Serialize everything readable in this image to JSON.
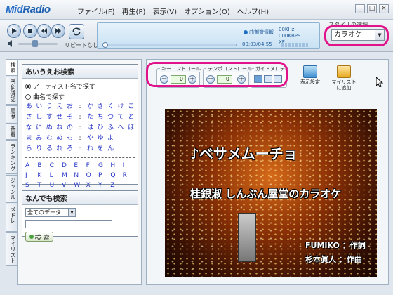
{
  "app": {
    "logo_part1": "Mid",
    "logo_part2": "Radio"
  },
  "menu": [
    "ファイル(F)",
    "再生(P)",
    "表示(V)",
    "オプション(O)",
    "ヘルプ(H)"
  ],
  "window_buttons": [
    "_",
    "□",
    "×"
  ],
  "player": {
    "repeat_label": "リピートなし",
    "status_text": "曲御遊情報",
    "khz": "00KHz",
    "kbps": "000KBPS",
    "xf": "XF",
    "time": "00:03/04:55"
  },
  "style_select": {
    "label": "スタイルの選択",
    "value": "カラオケ"
  },
  "side_tabs": [
    "検索",
    "予約確認",
    "履歴",
    "新着",
    "ランキング",
    "ジャンル",
    "メドレー",
    "マイリスト"
  ],
  "kana_search": {
    "title": "あいうえお検索",
    "options": [
      "アーティスト名で探す",
      "曲名で探す"
    ],
    "selected_index": 0,
    "kana_rows": [
      [
        "あ",
        "い",
        "う",
        "え",
        "お",
        ":",
        "か",
        "き",
        "く",
        "け",
        "こ"
      ],
      [
        "さ",
        "し",
        "す",
        "せ",
        "そ",
        ":",
        "た",
        "ち",
        "つ",
        "て",
        "と"
      ],
      [
        "な",
        "に",
        "ぬ",
        "ね",
        "の",
        ":",
        "は",
        "ひ",
        "ふ",
        "へ",
        "ほ"
      ],
      [
        "ま",
        "み",
        "む",
        "め",
        "も",
        ":",
        "や",
        "ゆ",
        "よ"
      ],
      [
        "ら",
        "り",
        "る",
        "れ",
        "ろ",
        ":",
        "わ",
        "を",
        "ん"
      ]
    ],
    "alpha": [
      "A",
      "B",
      "C",
      "D",
      "E",
      "F",
      "G",
      "H",
      "I",
      "J",
      "K",
      "L",
      "M",
      "N",
      "O",
      "P",
      "Q",
      "R",
      "S",
      "T",
      "U",
      "V",
      "W",
      "X",
      "Y",
      "Z"
    ]
  },
  "any_search": {
    "title": "なんでも検索",
    "select_value": "全てのデータ",
    "button_label": "検 索"
  },
  "toolbar": {
    "key_label": "キーコントロール",
    "key_value": "0",
    "tempo_label": "テンポコントロール",
    "tempo_value": "0",
    "guide_label": "ガイドメロディ",
    "display_label": "表示設定",
    "mylist_label": "マイリスト\nに追加"
  },
  "video": {
    "title": "♪ベサメムーチョ",
    "subtitle": "桂銀淑 しんぶん屋堂のカラオケ",
    "credit1_name": "FUMIKO",
    "credit1_role": "：作詞",
    "credit2_name": "杉本眞人",
    "credit2_role": "：作曲"
  },
  "colors": {
    "highlight": "#e0138a",
    "kana_link": "#2534c8"
  }
}
